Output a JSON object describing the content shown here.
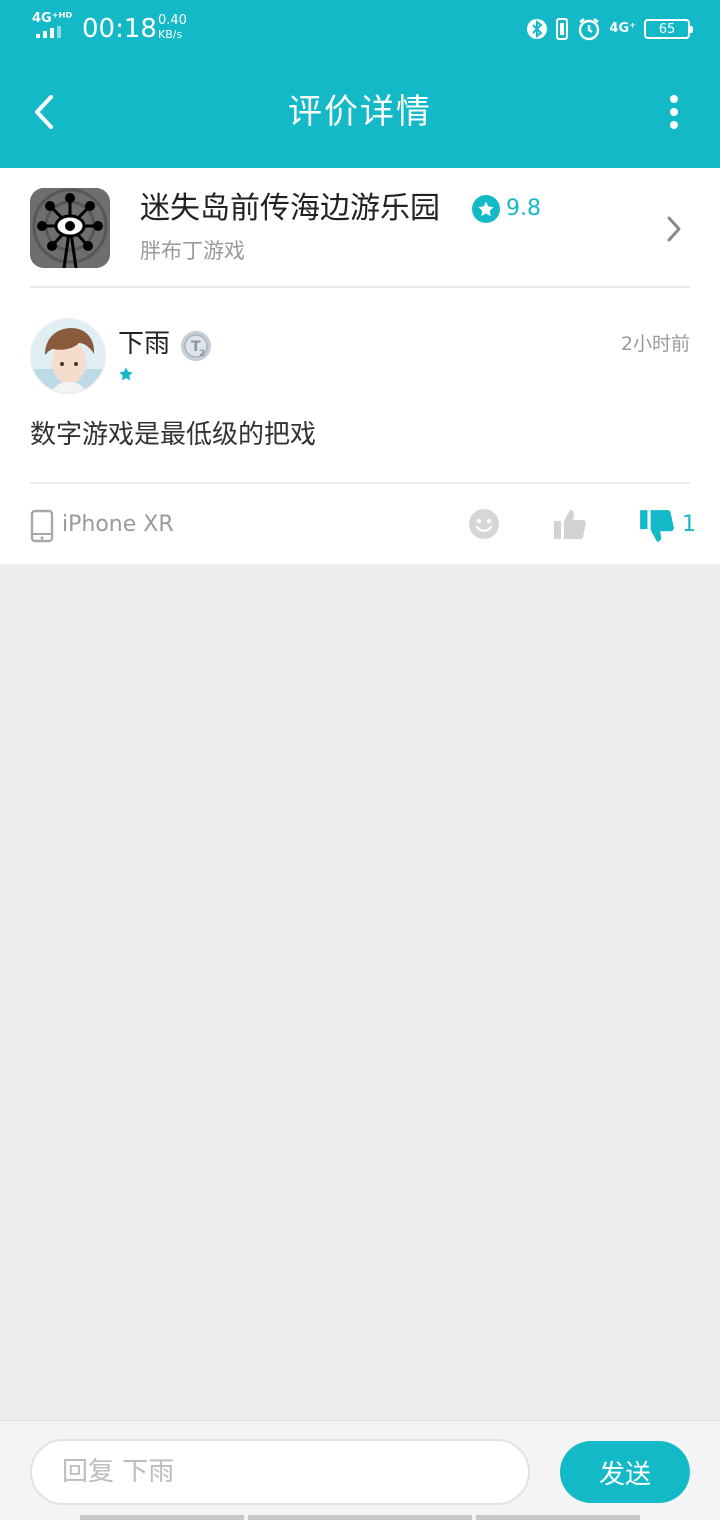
{
  "status_bar": {
    "network": "4G⁺ᴴᴰ",
    "time": "00:18",
    "speed_value": "0.40",
    "speed_unit": "KB/s",
    "network2": "4G⁺",
    "battery": "65",
    "icons": [
      "bluetooth-icon",
      "vibrate-icon",
      "alarm-icon",
      "signal-4g-icon",
      "battery-icon"
    ]
  },
  "toolbar": {
    "title": "评价详情",
    "back_icon": "chevron-left-icon",
    "more_icon": "more-vertical-icon"
  },
  "game": {
    "name": "迷失岛前传海边游乐园",
    "rating": "9.8",
    "developer": "胖布丁游戏",
    "icon": "ferris-wheel-eye-icon"
  },
  "review": {
    "username": "下雨",
    "level_badge": "T2",
    "stars": 1,
    "time": "2小时前",
    "text": "数字游戏是最低级的把戏",
    "device": "iPhone XR",
    "dislike_count": "1",
    "dislike_active": true
  },
  "reply": {
    "placeholder": "回复 下雨",
    "send_label": "发送"
  },
  "colors": {
    "accent": "#14b9c8",
    "background": "#ededed",
    "text_primary": "#222222",
    "text_secondary": "#9a9a9a"
  }
}
